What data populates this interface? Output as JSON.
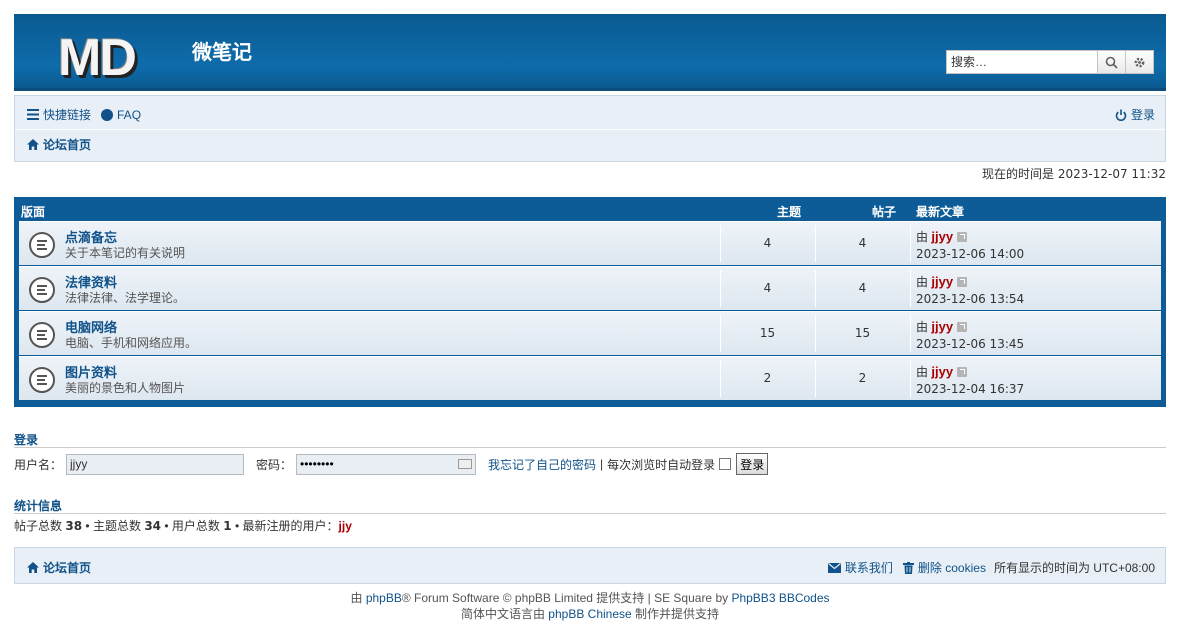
{
  "header": {
    "logo_text": "MD",
    "site_title": "微笔记",
    "search_placeholder": "搜索…"
  },
  "nav": {
    "quick_links": "快捷链接",
    "faq": "FAQ",
    "login": "登录",
    "board_index": "论坛首页"
  },
  "current_time": "现在的时间是 2023-12-07 11:32",
  "forum_table": {
    "headers": {
      "forum": "版面",
      "topics": "主题",
      "posts": "帖子",
      "last_post": "最新文章"
    },
    "rows": [
      {
        "name": "点滴备忘",
        "desc": "关于本笔记的有关说明",
        "topics": "4",
        "posts": "4",
        "by": "由",
        "user": "jjyy",
        "date": "2023-12-06 14:00"
      },
      {
        "name": "法律资料",
        "desc": "法律法律、法学理论。",
        "topics": "4",
        "posts": "4",
        "by": "由",
        "user": "jjyy",
        "date": "2023-12-06 13:54"
      },
      {
        "name": "电脑网络",
        "desc": "电脑、手机和网络应用。",
        "topics": "15",
        "posts": "15",
        "by": "由",
        "user": "jjyy",
        "date": "2023-12-06 13:45"
      },
      {
        "name": "图片资料",
        "desc": "美丽的景色和人物图片",
        "topics": "2",
        "posts": "2",
        "by": "由",
        "user": "jjyy",
        "date": "2023-12-04 16:37"
      }
    ]
  },
  "login_form": {
    "title": "登录",
    "username_label": "用户名：",
    "username_value": "jjyy",
    "password_label": "密码：",
    "password_value": "••••••••",
    "forgot": "我忘记了自己的密码",
    "separator": "|",
    "autologin": "每次浏览时自动登录",
    "submit": "登录"
  },
  "stats": {
    "title": "统计信息",
    "posts_label": "帖子总数",
    "posts": "38",
    "topics_label": "主题总数",
    "topics": "34",
    "users_label": "用户总数",
    "users": "1",
    "newest_label": "最新注册的用户：",
    "newest": "jjy",
    "bullet": "•"
  },
  "footer_nav": {
    "board_index": "论坛首页",
    "contact": "联系我们",
    "delete_cookies": "删除 cookies",
    "timezone": "所有显示的时间为 UTC+08:00"
  },
  "copyright": {
    "line1_pre": "由 ",
    "phpbb": "phpBB",
    "line1_mid": "® Forum Software © phpBB Limited 提供支持 | SE Square by ",
    "phpbb3bbcodes": "PhpBB3 BBCodes",
    "line2_pre": "简体中文语言由 ",
    "phpbb_chinese": "phpBB Chinese",
    "line2_post": " 制作并提供支持"
  },
  "colors": {
    "header_blue": "#0e6cab",
    "link": "#105289",
    "username": "#aa0000",
    "nav_bg": "#e8eff6"
  }
}
